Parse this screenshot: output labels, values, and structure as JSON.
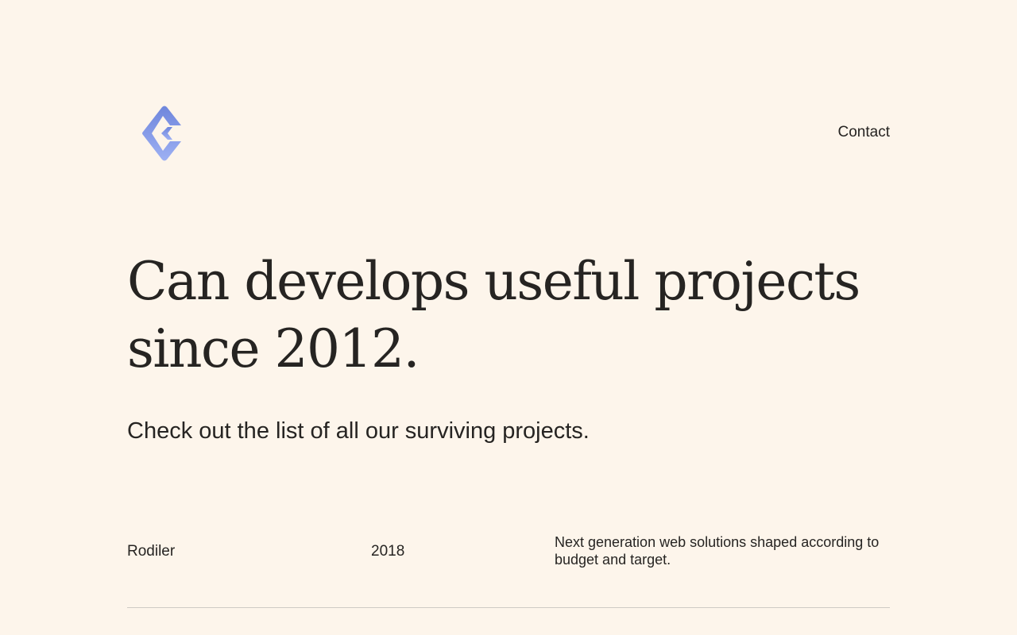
{
  "header": {
    "logo_icon": "diamond-c-logo-icon",
    "contact_label": "Contact"
  },
  "hero": {
    "headline": "Can develops useful projects since 2012.",
    "subtitle": "Check out the list of all our surviving projects."
  },
  "projects": [
    {
      "name": "Rodiler",
      "year": "2018",
      "description": "Next generation web solutions shaped according to budget and target."
    }
  ],
  "colors": {
    "background": "#fdf5eb",
    "text": "#262422",
    "logo_gradient_top": "#6f86dc",
    "logo_gradient_bottom": "#9db0f3",
    "divider": "#cfcac4"
  }
}
